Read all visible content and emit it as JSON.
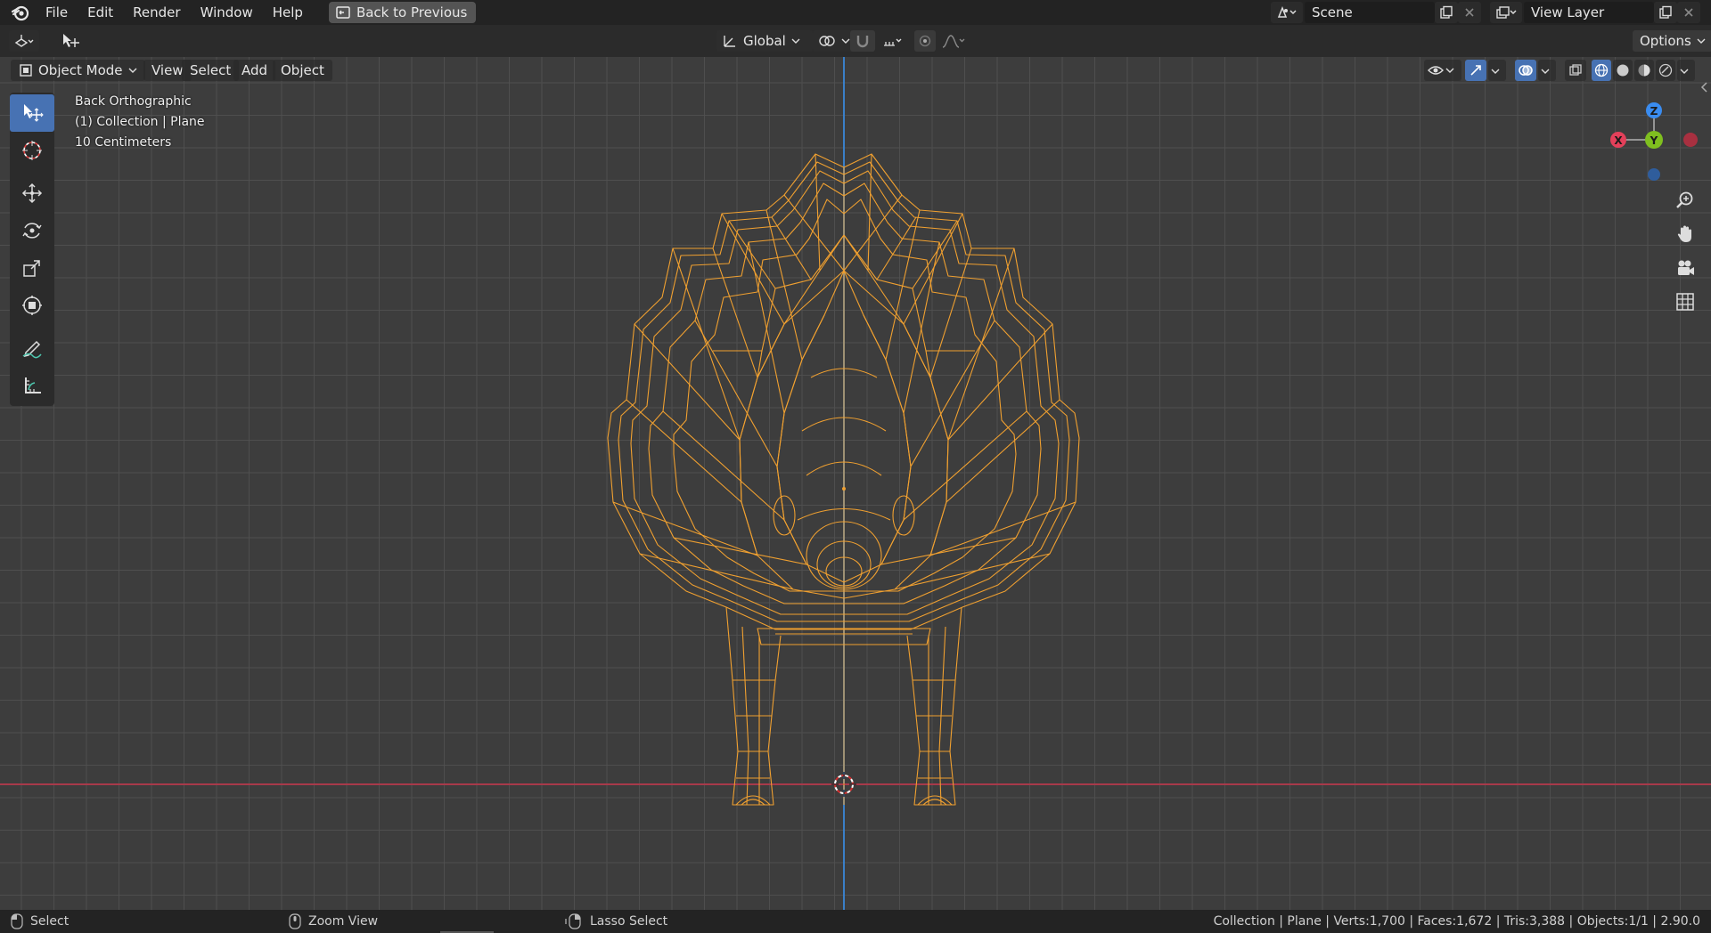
{
  "menu": {
    "items": [
      "File",
      "Edit",
      "Render",
      "Window",
      "Help"
    ],
    "back_to_previous": "Back to Previous"
  },
  "scene": {
    "name": "Scene"
  },
  "view_layer": {
    "name": "View Layer"
  },
  "tool_header": {
    "transform_orientation": "Global",
    "options_label": "Options"
  },
  "viewport_header": {
    "mode": "Object Mode",
    "menus": [
      "View",
      "Select",
      "Add",
      "Object"
    ]
  },
  "overlay": {
    "view_name": "Back Orthographic",
    "collection": "(1) Collection | Plane",
    "scale": "10 Centimeters"
  },
  "gizmo": {
    "z": "Z",
    "x": "X",
    "y": "Y"
  },
  "status": {
    "select": "Select",
    "zoom_view": "Zoom View",
    "lasso_select": "Lasso Select",
    "stats": "Collection | Plane | Verts:1,700 | Faces:1,672 | Tris:3,388 | Objects:1/1 | 2.90.0"
  },
  "colors": {
    "accent": "#4772b3",
    "wire": "#f0a030",
    "x_axis": "#e3405a",
    "y_axis": "#7fbf1f",
    "z_axis": "#3a8cf0"
  }
}
